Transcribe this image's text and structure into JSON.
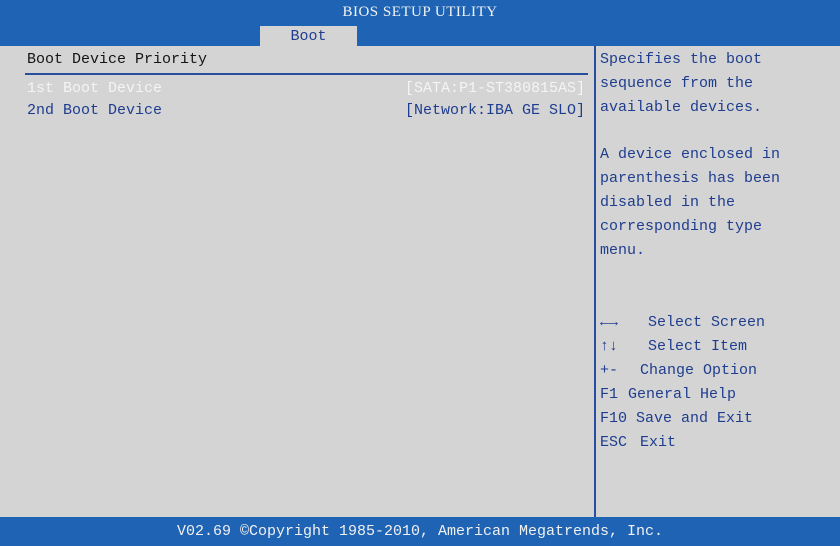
{
  "header": {
    "title": "BIOS SETUP UTILITY",
    "tabs": [
      {
        "label": "Boot",
        "active": true
      }
    ]
  },
  "boot": {
    "section_title": "Boot Device Priority",
    "items": [
      {
        "label": "1st Boot Device",
        "value": "[SATA:P1-ST380815AS]",
        "selected": true
      },
      {
        "label": "2nd Boot Device",
        "value": "[Network:IBA GE SLO]",
        "selected": false
      }
    ]
  },
  "help": {
    "lines": [
      "Specifies the boot",
      "sequence from the",
      "available devices.",
      "",
      "A device enclosed in",
      "parenthesis has been",
      "disabled in the",
      "corresponding type",
      "menu."
    ],
    "keys": [
      {
        "key": "←→",
        "action": "Select Screen",
        "icon": "left-right-arrow-icon"
      },
      {
        "key": "↑↓",
        "action": "Select Item",
        "icon": "up-down-arrow-icon"
      },
      {
        "key": "+-",
        "action": "Change Option"
      },
      {
        "key": "F1",
        "action": "General Help"
      },
      {
        "key": "F10",
        "action": "Save and Exit"
      },
      {
        "key": "ESC",
        "action": "Exit"
      }
    ]
  },
  "footer": {
    "text": "V02.69 ©Copyright 1985-2010, American Megatrends, Inc."
  },
  "colors": {
    "bar_blue": "#1f64b4",
    "background_gray": "#d4d4d4",
    "text_blue": "#1e3d8f",
    "selected_text": "#f4f4f4",
    "divider": "#2a4e9e"
  }
}
